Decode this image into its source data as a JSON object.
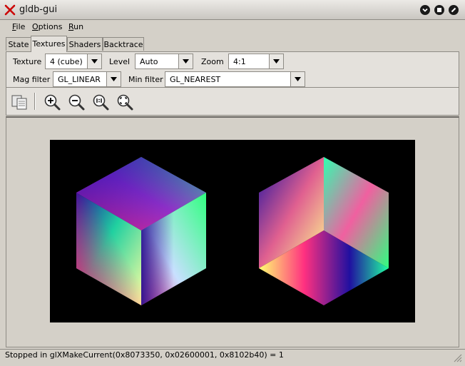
{
  "window": {
    "title": "gldb-gui"
  },
  "menu": [
    {
      "label": "File",
      "mnemonic": "F",
      "rest": "ile"
    },
    {
      "label": "Options",
      "mnemonic": "O",
      "rest": "ptions"
    },
    {
      "label": "Run",
      "mnemonic": "R",
      "rest": "un"
    }
  ],
  "tabs": [
    "State",
    "Textures",
    "Shaders",
    "Backtrace"
  ],
  "active_tab": "Textures",
  "controls": {
    "texture_label": "Texture",
    "texture_value": "4 (cube)",
    "level_label": "Level",
    "level_value": "Auto",
    "zoom_label": "Zoom",
    "zoom_value": "4:1",
    "mag_filter_label": "Mag filter",
    "mag_filter_value": "GL_LINEAR",
    "min_filter_label": "Min filter",
    "min_filter_value": "GL_NEAREST"
  },
  "toolbar": {
    "icons": [
      "copy-icon",
      "zoom-in-icon",
      "zoom-out-icon",
      "zoom-1to1-icon",
      "zoom-fit-icon"
    ]
  },
  "status": {
    "text": "Stopped in glXMakeCurrent(0x8073350, 0x02600001, 0x8102b40) = 1"
  },
  "colors": {
    "accent_red": "#cc0000",
    "canvas_bg": "#000000",
    "window_bg": "#d4d0c8"
  }
}
